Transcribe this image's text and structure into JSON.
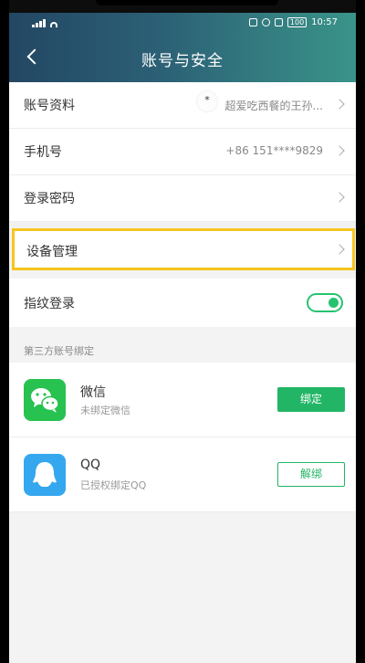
{
  "status_bar": {
    "battery": "100",
    "time": "10:57"
  },
  "header": {
    "title": "账号与安全"
  },
  "account_rows": [
    {
      "label": "账号资料",
      "avatar_text": "*",
      "value": "超爱吃西餐的王孙..."
    },
    {
      "label": "手机号",
      "value": "+86 151****9829"
    },
    {
      "label": "登录密码",
      "value": ""
    }
  ],
  "device_row": {
    "label": "设备管理"
  },
  "fingerprint_row": {
    "label": "指纹登录",
    "enabled": true
  },
  "third_party": {
    "section_title": "第三方账号绑定",
    "items": [
      {
        "name": "微信",
        "desc": "未绑定微信",
        "action": "绑定",
        "icon": "wechat-icon"
      },
      {
        "name": "QQ",
        "desc": "已授权绑定QQ",
        "action": "解绑",
        "icon": "qq-icon"
      }
    ]
  },
  "colors": {
    "header_start": "#234763",
    "header_end": "#3a9489",
    "accent_green": "#23b566",
    "highlight_yellow": "#f6c51e"
  }
}
